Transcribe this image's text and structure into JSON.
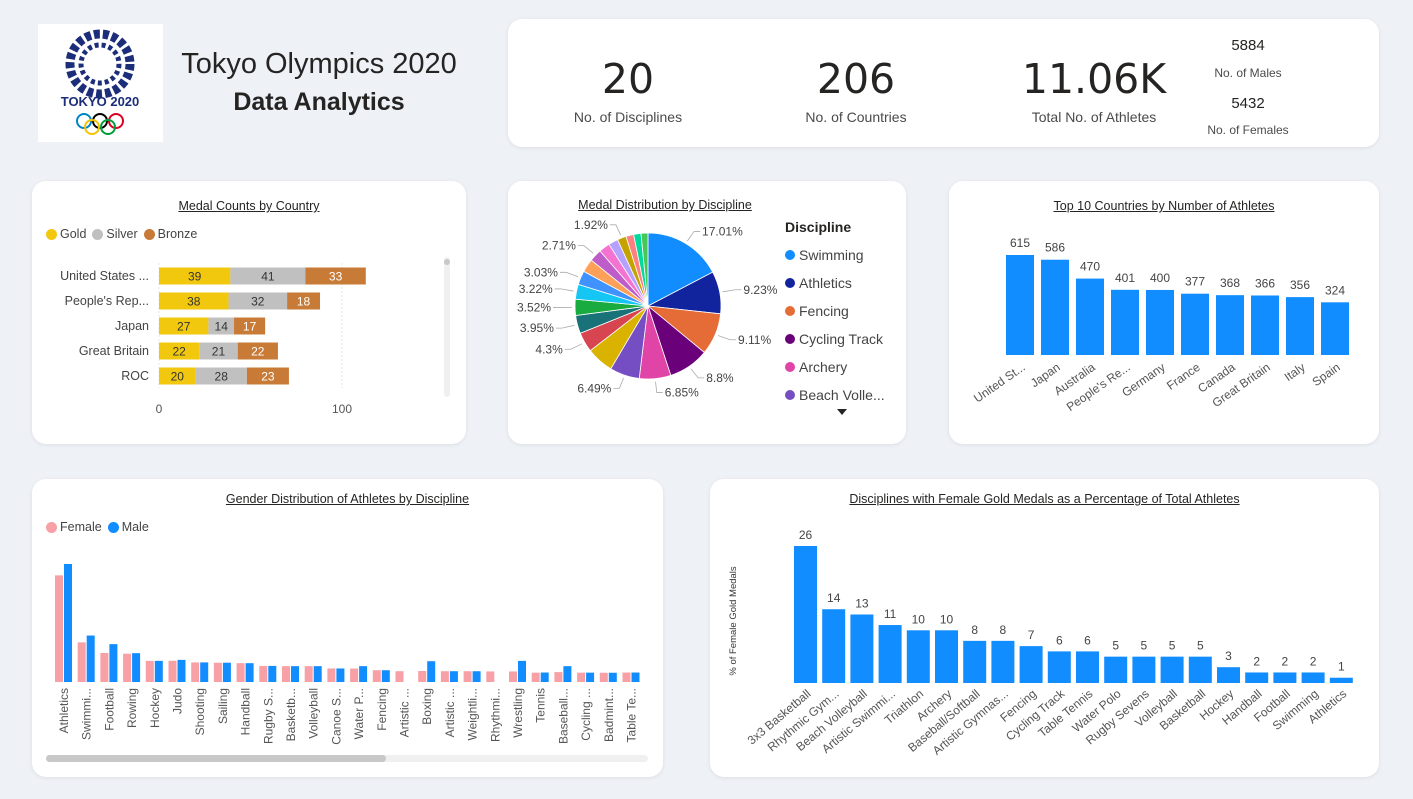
{
  "header": {
    "logo_text": "TOKYO 2020",
    "title_line1": "Tokyo Olympics 2020",
    "title_line2": "Data Analytics"
  },
  "kpis": {
    "disciplines": {
      "value": "20",
      "label": "No. of Disciplines"
    },
    "countries": {
      "value": "206",
      "label": "No. of Countries"
    },
    "athletes": {
      "value": "11.06K",
      "label": "Total No. of Athletes"
    },
    "males": {
      "value": "5884",
      "label": "No. of  Males"
    },
    "females": {
      "value": "5432",
      "label": "No. of Females"
    }
  },
  "colors": {
    "gold": "#f2c80f",
    "silver": "#c0c0c0",
    "bronze": "#c87b37",
    "blue": "#118dff",
    "female": "#f7a1a6"
  },
  "medal_chart": {
    "title": "Medal Counts by Country",
    "legend": [
      "Gold",
      "Silver",
      "Bronze"
    ],
    "xticks": [
      "0",
      "100"
    ]
  },
  "pie_chart": {
    "title": "Medal Distribution by Discipline",
    "legend_title": "Discipline",
    "legend_items": [
      "Swimming",
      "Athletics",
      "Fencing",
      "Cycling Track",
      "Archery",
      "Beach Volle..."
    ]
  },
  "top10_chart": {
    "title": "Top 10 Countries by Number of Athletes"
  },
  "gender_chart": {
    "title": "Gender Distribution of Athletes by Discipline",
    "legend": [
      "Female",
      "Male"
    ]
  },
  "female_gold_chart": {
    "title": "Disciplines with Female Gold Medals as a Percentage of Total Athletes",
    "ylabel": "% of Female Gold Medals"
  },
  "chart_data": [
    {
      "type": "bar",
      "orientation": "horizontal-stacked",
      "title": "Medal Counts by Country",
      "categories": [
        "United States ...",
        "People's Rep...",
        "Japan",
        "Great Britain",
        "ROC"
      ],
      "series": [
        {
          "name": "Gold",
          "values": [
            39,
            38,
            27,
            22,
            20
          ]
        },
        {
          "name": "Silver",
          "values": [
            41,
            32,
            14,
            21,
            28
          ]
        },
        {
          "name": "Bronze",
          "values": [
            33,
            18,
            17,
            22,
            23
          ]
        }
      ],
      "xlim": [
        0,
        120
      ],
      "legend": "top-left",
      "grid": true
    },
    {
      "type": "pie",
      "title": "Medal Distribution by Discipline",
      "slices": [
        {
          "label": "17.01%",
          "value": 17.01,
          "color": "#118dff",
          "name": "Swimming"
        },
        {
          "label": "9.23%",
          "value": 9.23,
          "color": "#12239e",
          "name": "Athletics"
        },
        {
          "label": "9.11%",
          "value": 9.11,
          "color": "#e66c37",
          "name": "Fencing"
        },
        {
          "label": "8.8%",
          "value": 8.8,
          "color": "#6b007b",
          "name": "Cycling Track"
        },
        {
          "label": "6.85%",
          "value": 6.85,
          "color": "#e044a7",
          "name": "Archery"
        },
        {
          "label": "6.49%",
          "value": 6.49,
          "color": "#744ec2",
          "name": "Beach Volle..."
        },
        {
          "label": "",
          "value": 5.9,
          "color": "#d9b300"
        },
        {
          "label": "4.3%",
          "value": 4.3,
          "color": "#d64550"
        },
        {
          "label": "3.95%",
          "value": 3.95,
          "color": "#197278"
        },
        {
          "label": "3.52%",
          "value": 3.52,
          "color": "#1aab40"
        },
        {
          "label": "3.22%",
          "value": 3.22,
          "color": "#15c6f4"
        },
        {
          "label": "3.03%",
          "value": 3.03,
          "color": "#4092ff"
        },
        {
          "label": "",
          "value": 2.9,
          "color": "#ffa058"
        },
        {
          "label": "2.71%",
          "value": 2.71,
          "color": "#be5dc9"
        },
        {
          "label": "",
          "value": 2.4,
          "color": "#f472d0"
        },
        {
          "label": "",
          "value": 2.1,
          "color": "#b5a1ff"
        },
        {
          "label": "1.92%",
          "value": 1.92,
          "color": "#c4a200"
        },
        {
          "label": "",
          "value": 1.7,
          "color": "#ff8080"
        },
        {
          "label": "",
          "value": 1.6,
          "color": "#00db9d"
        },
        {
          "label": "",
          "value": 1.5,
          "color": "#48c757"
        }
      ],
      "legend": "right"
    },
    {
      "type": "bar",
      "title": "Top 10 Countries by Number of Athletes",
      "categories": [
        "United St...",
        "Japan",
        "Australia",
        "People's Re...",
        "Germany",
        "France",
        "Canada",
        "Great Britain",
        "Italy",
        "Spain"
      ],
      "values": [
        615,
        586,
        470,
        401,
        400,
        377,
        368,
        366,
        356,
        324
      ],
      "ylim": [
        0,
        650
      ]
    },
    {
      "type": "bar",
      "title": "Gender Distribution of Athletes by Discipline",
      "categories": [
        "Athletics",
        "Swimmi...",
        "Football",
        "Rowing",
        "Hockey",
        "Judo",
        "Shooting",
        "Sailing",
        "Handball",
        "Rugby S...",
        "Basketb...",
        "Volleyball",
        "Canoe S...",
        "Water P...",
        "Fencing",
        "Artistic ...",
        "Boxing",
        "Artistic ...",
        "Weightli...",
        "Rhythmi...",
        "Wrestling",
        "Tennis",
        "Baseball...",
        "Cycling ...",
        "Badmint...",
        "Table Te..."
      ],
      "series": [
        {
          "name": "Female",
          "values": [
            969,
            360,
            264,
            257,
            192,
            193,
            178,
            175,
            171,
            146,
            144,
            144,
            123,
            122,
            107,
            98,
            100,
            98,
            98,
            96,
            96,
            85,
            90,
            85,
            84,
            86
          ]
        },
        {
          "name": "Male",
          "values": [
            1072,
            422,
            344,
            262,
            192,
            201,
            178,
            175,
            171,
            146,
            144,
            144,
            123,
            144,
            107,
            0,
            189,
            98,
            98,
            0,
            192,
            86,
            144,
            85,
            84,
            86
          ]
        }
      ],
      "ylim": [
        0,
        1100
      ],
      "legend": "top-left"
    },
    {
      "type": "bar",
      "title": "Disciplines with Female Gold Medals as a Percentage of Total Athletes",
      "ylabel": "% of Female Gold Medals",
      "categories": [
        "3x3 Basketball",
        "Rhythmic Gym...",
        "Beach Volleyball",
        "Artistic Swimmi...",
        "Triathlon",
        "Archery",
        "Baseball/Softball",
        "Artistic Gymnas...",
        "Fencing",
        "Cycling Track",
        "Table Tennis",
        "Water Polo",
        "Rugby Sevens",
        "Volleyball",
        "Basketball",
        "Hockey",
        "Handball",
        "Football",
        "Swimming",
        "Athletics"
      ],
      "values": [
        26,
        14,
        13,
        11,
        10,
        10,
        8,
        8,
        7,
        6,
        6,
        5,
        5,
        5,
        5,
        3,
        2,
        2,
        2,
        1
      ],
      "ylim": [
        0,
        28
      ]
    }
  ]
}
